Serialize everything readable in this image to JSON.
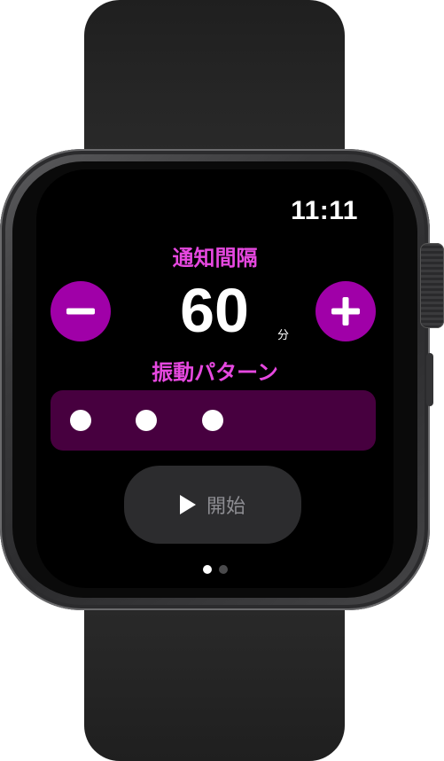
{
  "status_bar": {
    "time": "11:11"
  },
  "interval": {
    "title": "通知間隔",
    "value": "60",
    "unit": "分",
    "decrement_icon": "minus-icon",
    "increment_icon": "plus-icon"
  },
  "vibration": {
    "title": "振動パターン",
    "pattern_dots": 3
  },
  "start_button": {
    "icon": "play-icon",
    "label": "開始"
  },
  "pagination": {
    "current": 1,
    "total": 2
  },
  "colors": {
    "accent": "#e648e0",
    "button_fill": "#a000a8",
    "pattern_bg": "#47003f",
    "start_bg": "#2c2c2e",
    "start_label": "#8e8e93"
  }
}
